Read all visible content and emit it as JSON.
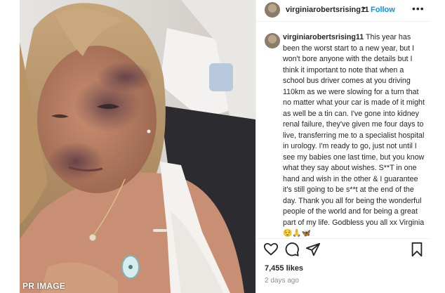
{
  "header": {
    "username": "virginiarobertsrising11",
    "separator": "•",
    "follow_label": "Follow",
    "more_label": "•••"
  },
  "post": {
    "caption_username": "virginiarobertsrising11",
    "caption_text": "This year has been the worst start to a new year, but I won't bore anyone with the details but I think it important to note that when a school bus driver comes at you driving 110km as we were slowing for a turn that no matter what your car is made of it might as well be a tin can. I've gone into kidney renal failure, they've given me four days to live, transferring me to a specialist hospital in urology. I'm ready to go, just not until I see my babies one last time, but you know what they say about wishes. S**T in one hand and wish in the other & I guarantee it's still going to be s**t at the end of the day. Thank you all for being the wonderful people of the world and for being a great part of my life. Godbless you all xx Virginia 😌🙏🦋",
    "likes": "7,455 likes",
    "time_ago": "2 days ago"
  },
  "icons": {
    "like": "heart-icon",
    "comment": "comment-icon",
    "share": "share-icon",
    "save": "bookmark-icon"
  },
  "photo": {
    "credit": "PR IMAGE"
  },
  "colors": {
    "follow": "#0095f6",
    "text": "#262626",
    "muted": "#8e8e8e"
  }
}
